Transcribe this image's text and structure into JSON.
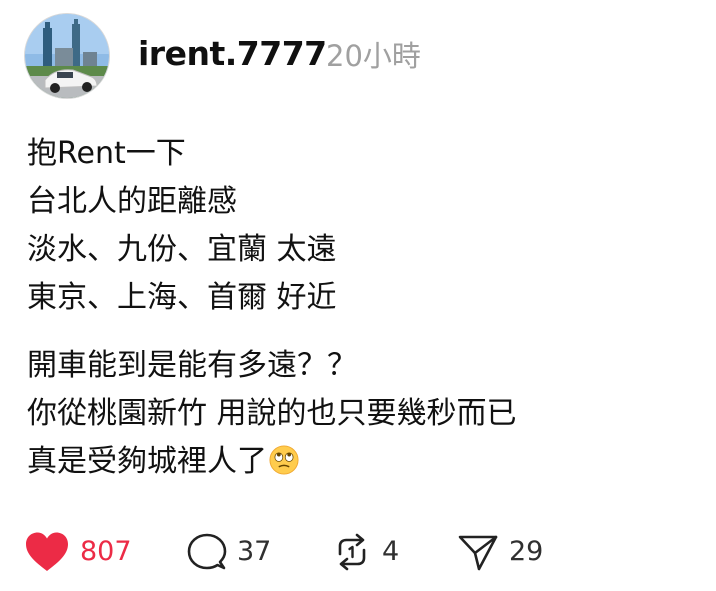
{
  "post": {
    "username": "irent.7777",
    "timestamp": "20小時",
    "paragraphs": [
      [
        "抱Rent一下",
        "台北人的距離感",
        "淡水、九份、宜蘭 太遠",
        "東京、上海、首爾 好近"
      ],
      [
        "開車能到是能有多遠？？",
        "你從桃園新竹 用說的也只要幾秒而已",
        "真是受夠城裡人了"
      ]
    ],
    "emoji": "face-with-rolling-eyes",
    "actions": {
      "like_count": "807",
      "reply_count": "37",
      "repost_count": "4",
      "share_count": "29"
    },
    "colors": {
      "liked": "#ec2b46",
      "timestamp": "#a0a0a0",
      "text": "#111111"
    }
  }
}
